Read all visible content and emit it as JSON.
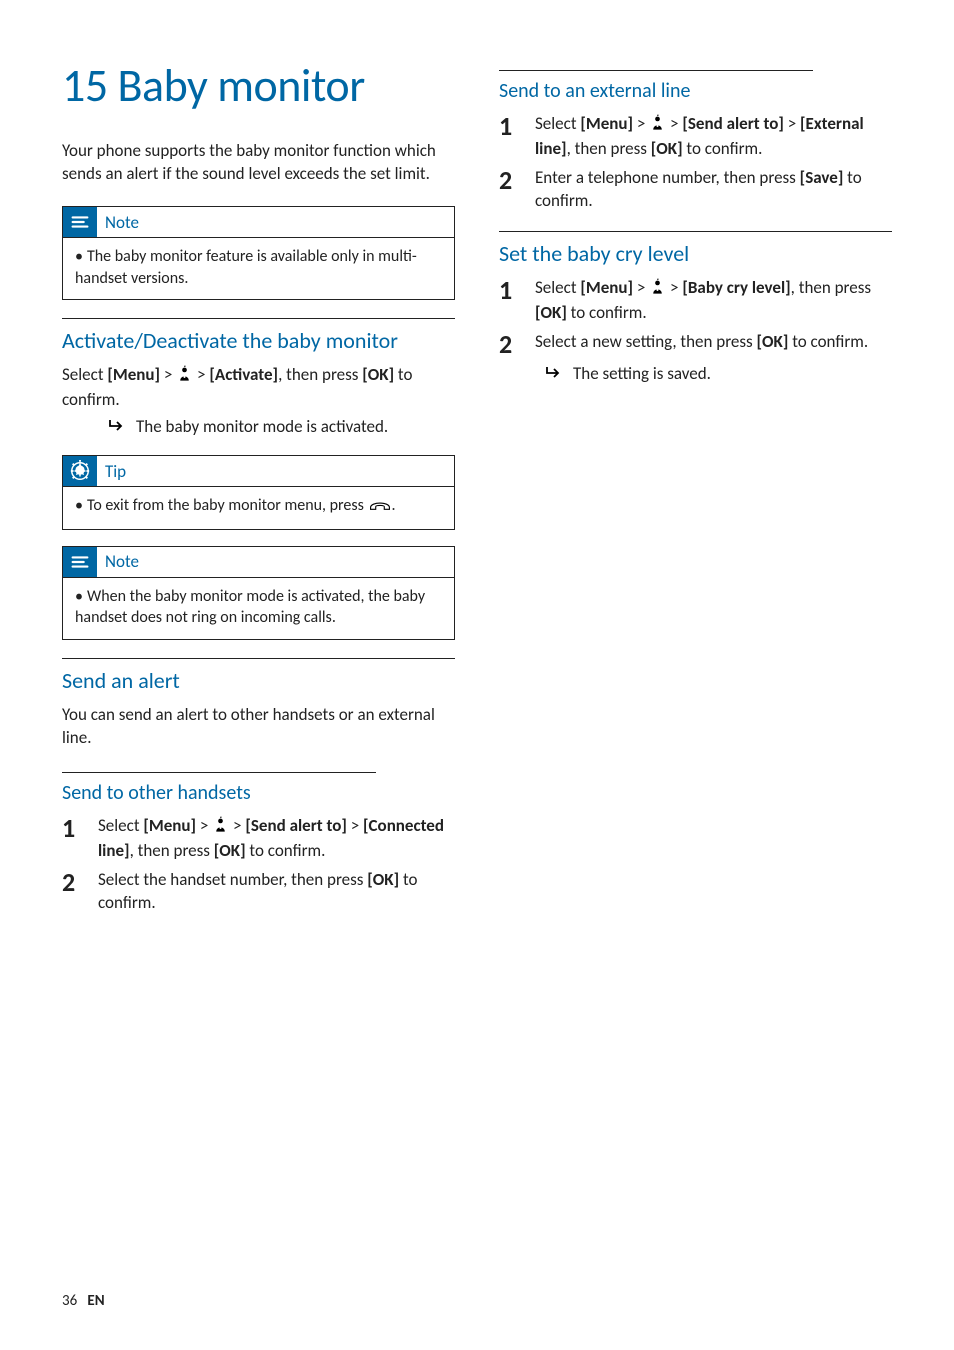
{
  "chapter_title": "15 Baby monitor",
  "intro": "Your phone supports the baby monitor function which sends an alert if the sound level exceeds the set limit.",
  "labels": {
    "note": "Note",
    "tip": "Tip"
  },
  "note_top": "The baby monitor feature is available only in multi-handset versions.",
  "activate": {
    "heading": "Activate/Deactivate the baby monitor",
    "body_prefix": "Select ",
    "body_menu": "[Menu]",
    "body_gt1": " > ",
    "body_gt2": " > ",
    "body_activate": "[Activate]",
    "body_mid": ", then press ",
    "body_ok": "[OK]",
    "body_suffix": " to confirm.",
    "result": "The baby monitor mode is activated."
  },
  "tip_text_prefix": "To exit from the baby monitor menu, press ",
  "tip_text_suffix": ".",
  "note2": "When the baby monitor mode is activated, the baby handset does not ring on incoming calls.",
  "send_alert": {
    "heading": "Send an alert",
    "body": "You can send an alert to other handsets or an external line."
  },
  "send_other": {
    "heading": "Send to other handsets",
    "step1": {
      "p1": "Select ",
      "menu": "[Menu]",
      "gt1": " > ",
      "gt2": " > ",
      "sendto": "[Send alert to]",
      "gt3": " > ",
      "connected": "[Connected line]",
      "mid": ", then press ",
      "ok": "[OK]",
      "suf": " to confirm."
    },
    "step2": {
      "p1": "Select the handset number, then press ",
      "ok": "[OK]",
      "suf": " to confirm."
    }
  },
  "send_ext": {
    "heading": "Send to an external line",
    "step1": {
      "p1": "Select ",
      "menu": "[Menu]",
      "gt1": " > ",
      "gt2": " > ",
      "sendto": "[Send alert to]",
      "gt3": " > ",
      "ext": "[External line]",
      "mid": ", then press ",
      "ok": "[OK]",
      "suf": " to confirm."
    },
    "step2": {
      "p1": "Enter a telephone number, then press ",
      "save": "[Save]",
      "suf": " to confirm."
    }
  },
  "cry": {
    "heading": "Set the baby cry level",
    "step1": {
      "p1": "Select ",
      "menu": "[Menu]",
      "gt1": " > ",
      "gt2": " > ",
      "bcl": "[Baby cry level]",
      "mid": ", then press ",
      "ok": "[OK]",
      "suf": " to confirm."
    },
    "step2": {
      "p1": "Select a new setting, then press ",
      "ok": "[OK]",
      "suf": " to confirm."
    },
    "result": "The setting is saved."
  },
  "footer": {
    "page": "36",
    "lang": "EN"
  }
}
